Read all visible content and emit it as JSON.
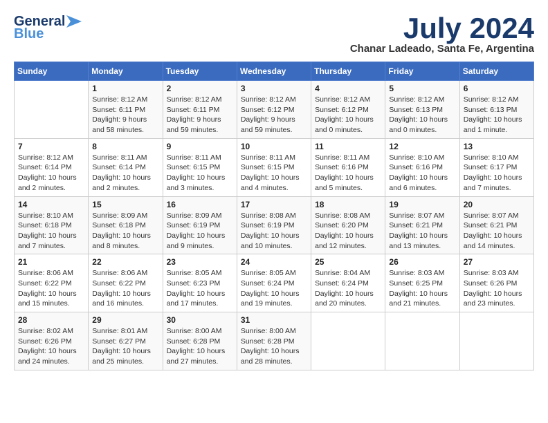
{
  "header": {
    "logo_line1": "General",
    "logo_line2": "Blue",
    "month_title": "July 2024",
    "subtitle": "Chanar Ladeado, Santa Fe, Argentina"
  },
  "calendar": {
    "days_of_week": [
      "Sunday",
      "Monday",
      "Tuesday",
      "Wednesday",
      "Thursday",
      "Friday",
      "Saturday"
    ],
    "weeks": [
      [
        {
          "day": "",
          "info": ""
        },
        {
          "day": "1",
          "info": "Sunrise: 8:12 AM\nSunset: 6:11 PM\nDaylight: 9 hours\nand 58 minutes."
        },
        {
          "day": "2",
          "info": "Sunrise: 8:12 AM\nSunset: 6:11 PM\nDaylight: 9 hours\nand 59 minutes."
        },
        {
          "day": "3",
          "info": "Sunrise: 8:12 AM\nSunset: 6:12 PM\nDaylight: 9 hours\nand 59 minutes."
        },
        {
          "day": "4",
          "info": "Sunrise: 8:12 AM\nSunset: 6:12 PM\nDaylight: 10 hours\nand 0 minutes."
        },
        {
          "day": "5",
          "info": "Sunrise: 8:12 AM\nSunset: 6:13 PM\nDaylight: 10 hours\nand 0 minutes."
        },
        {
          "day": "6",
          "info": "Sunrise: 8:12 AM\nSunset: 6:13 PM\nDaylight: 10 hours\nand 1 minute."
        }
      ],
      [
        {
          "day": "7",
          "info": "Sunrise: 8:12 AM\nSunset: 6:14 PM\nDaylight: 10 hours\nand 2 minutes."
        },
        {
          "day": "8",
          "info": "Sunrise: 8:11 AM\nSunset: 6:14 PM\nDaylight: 10 hours\nand 2 minutes."
        },
        {
          "day": "9",
          "info": "Sunrise: 8:11 AM\nSunset: 6:15 PM\nDaylight: 10 hours\nand 3 minutes."
        },
        {
          "day": "10",
          "info": "Sunrise: 8:11 AM\nSunset: 6:15 PM\nDaylight: 10 hours\nand 4 minutes."
        },
        {
          "day": "11",
          "info": "Sunrise: 8:11 AM\nSunset: 6:16 PM\nDaylight: 10 hours\nand 5 minutes."
        },
        {
          "day": "12",
          "info": "Sunrise: 8:10 AM\nSunset: 6:16 PM\nDaylight: 10 hours\nand 6 minutes."
        },
        {
          "day": "13",
          "info": "Sunrise: 8:10 AM\nSunset: 6:17 PM\nDaylight: 10 hours\nand 7 minutes."
        }
      ],
      [
        {
          "day": "14",
          "info": "Sunrise: 8:10 AM\nSunset: 6:18 PM\nDaylight: 10 hours\nand 7 minutes."
        },
        {
          "day": "15",
          "info": "Sunrise: 8:09 AM\nSunset: 6:18 PM\nDaylight: 10 hours\nand 8 minutes."
        },
        {
          "day": "16",
          "info": "Sunrise: 8:09 AM\nSunset: 6:19 PM\nDaylight: 10 hours\nand 9 minutes."
        },
        {
          "day": "17",
          "info": "Sunrise: 8:08 AM\nSunset: 6:19 PM\nDaylight: 10 hours\nand 10 minutes."
        },
        {
          "day": "18",
          "info": "Sunrise: 8:08 AM\nSunset: 6:20 PM\nDaylight: 10 hours\nand 12 minutes."
        },
        {
          "day": "19",
          "info": "Sunrise: 8:07 AM\nSunset: 6:21 PM\nDaylight: 10 hours\nand 13 minutes."
        },
        {
          "day": "20",
          "info": "Sunrise: 8:07 AM\nSunset: 6:21 PM\nDaylight: 10 hours\nand 14 minutes."
        }
      ],
      [
        {
          "day": "21",
          "info": "Sunrise: 8:06 AM\nSunset: 6:22 PM\nDaylight: 10 hours\nand 15 minutes."
        },
        {
          "day": "22",
          "info": "Sunrise: 8:06 AM\nSunset: 6:22 PM\nDaylight: 10 hours\nand 16 minutes."
        },
        {
          "day": "23",
          "info": "Sunrise: 8:05 AM\nSunset: 6:23 PM\nDaylight: 10 hours\nand 17 minutes."
        },
        {
          "day": "24",
          "info": "Sunrise: 8:05 AM\nSunset: 6:24 PM\nDaylight: 10 hours\nand 19 minutes."
        },
        {
          "day": "25",
          "info": "Sunrise: 8:04 AM\nSunset: 6:24 PM\nDaylight: 10 hours\nand 20 minutes."
        },
        {
          "day": "26",
          "info": "Sunrise: 8:03 AM\nSunset: 6:25 PM\nDaylight: 10 hours\nand 21 minutes."
        },
        {
          "day": "27",
          "info": "Sunrise: 8:03 AM\nSunset: 6:26 PM\nDaylight: 10 hours\nand 23 minutes."
        }
      ],
      [
        {
          "day": "28",
          "info": "Sunrise: 8:02 AM\nSunset: 6:26 PM\nDaylight: 10 hours\nand 24 minutes."
        },
        {
          "day": "29",
          "info": "Sunrise: 8:01 AM\nSunset: 6:27 PM\nDaylight: 10 hours\nand 25 minutes."
        },
        {
          "day": "30",
          "info": "Sunrise: 8:00 AM\nSunset: 6:28 PM\nDaylight: 10 hours\nand 27 minutes."
        },
        {
          "day": "31",
          "info": "Sunrise: 8:00 AM\nSunset: 6:28 PM\nDaylight: 10 hours\nand 28 minutes."
        },
        {
          "day": "",
          "info": ""
        },
        {
          "day": "",
          "info": ""
        },
        {
          "day": "",
          "info": ""
        }
      ]
    ]
  }
}
